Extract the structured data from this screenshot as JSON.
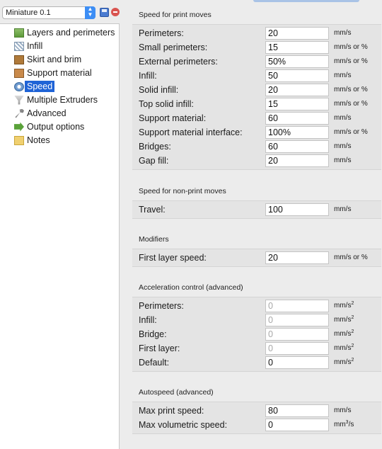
{
  "sidebar": {
    "preset_value": "Miniature 0.1",
    "items": [
      {
        "label": "Layers and perimeters",
        "icon": "layers-icon"
      },
      {
        "label": "Infill",
        "icon": "infill-icon"
      },
      {
        "label": "Skirt and brim",
        "icon": "skirt-brim-icon"
      },
      {
        "label": "Support material",
        "icon": "support-material-icon"
      },
      {
        "label": "Speed",
        "icon": "speed-icon",
        "selected": true
      },
      {
        "label": "Multiple Extruders",
        "icon": "funnel-icon"
      },
      {
        "label": "Advanced",
        "icon": "wrench-icon"
      },
      {
        "label": "Output options",
        "icon": "output-arrow-icon"
      },
      {
        "label": "Notes",
        "icon": "folder-icon"
      }
    ]
  },
  "sections": {
    "print_moves": {
      "title": "Speed for print moves",
      "rows": [
        {
          "label": "Perimeters:",
          "value": "20",
          "unit": "mm/s"
        },
        {
          "label": "Small perimeters:",
          "value": "15",
          "unit": "mm/s or %"
        },
        {
          "label": "External perimeters:",
          "value": "50%",
          "unit": "mm/s or %"
        },
        {
          "label": "Infill:",
          "value": "50",
          "unit": "mm/s"
        },
        {
          "label": "Solid infill:",
          "value": "20",
          "unit": "mm/s or %"
        },
        {
          "label": "Top solid infill:",
          "value": "15",
          "unit": "mm/s or %"
        },
        {
          "label": "Support material:",
          "value": "60",
          "unit": "mm/s"
        },
        {
          "label": "Support material interface:",
          "value": "100%",
          "unit": "mm/s or %"
        },
        {
          "label": "Bridges:",
          "value": "60",
          "unit": "mm/s"
        },
        {
          "label": "Gap fill:",
          "value": "20",
          "unit": "mm/s"
        }
      ]
    },
    "non_print": {
      "title": "Speed for non-print moves",
      "rows": [
        {
          "label": "Travel:",
          "value": "100",
          "unit": "mm/s"
        }
      ]
    },
    "modifiers": {
      "title": "Modifiers",
      "rows": [
        {
          "label": "First layer speed:",
          "value": "20",
          "unit": "mm/s or %"
        }
      ]
    },
    "acceleration": {
      "title": "Acceleration control (advanced)",
      "unit_base": "mm/s",
      "unit_sup": "2",
      "rows": [
        {
          "label": "Perimeters:",
          "value": "0"
        },
        {
          "label": "Infill:",
          "value": "0"
        },
        {
          "label": "Bridge:",
          "value": "0"
        },
        {
          "label": "First layer:",
          "value": "0"
        },
        {
          "label": "Default:",
          "value": "0"
        }
      ]
    },
    "autospeed": {
      "title": "Autospeed (advanced)",
      "rows": [
        {
          "label": "Max print speed:",
          "value": "80",
          "unit": "mm/s"
        },
        {
          "label": "Max volumetric speed:",
          "value": "0",
          "unit_base": "mm",
          "unit_sup": "3",
          "unit_tail": "/s"
        }
      ]
    }
  }
}
